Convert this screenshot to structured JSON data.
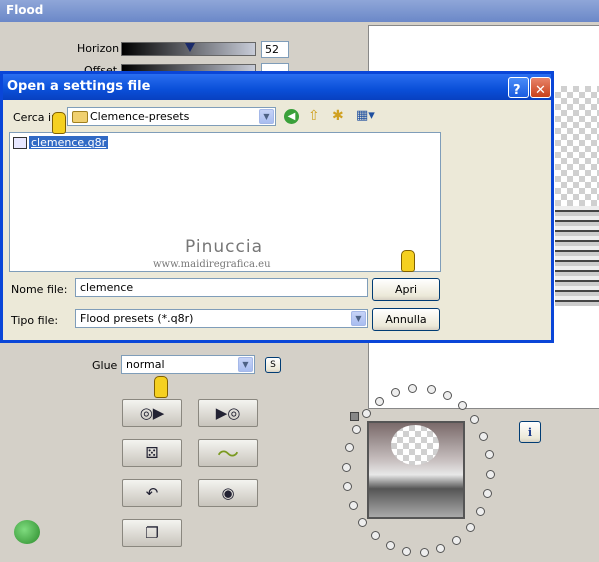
{
  "flood": {
    "title": "Flood",
    "horizon_label": "Horizon",
    "horizon_value": "52",
    "horizon_level": 0.52,
    "offset_label": "Offset",
    "glue_label": "Glue",
    "glue_value": "normal",
    "glue_s": "S",
    "info_label": "i"
  },
  "dialog": {
    "title": "Open a settings file",
    "help": "?",
    "close": "✕",
    "lookin_label": "Cerca in:",
    "lookin_value": "Clemence-presets",
    "files": [
      "clemence.q8r"
    ],
    "filename_label": "Nome file:",
    "filename_value": "clemence",
    "filetype_label": "Tipo file:",
    "filetype_value": "Flood presets (*.q8r)",
    "open_button": "Apri",
    "cancel_button": "Annulla"
  },
  "watermark": {
    "name": "Pinuccia",
    "url": "www.maidiregrafica.eu"
  }
}
